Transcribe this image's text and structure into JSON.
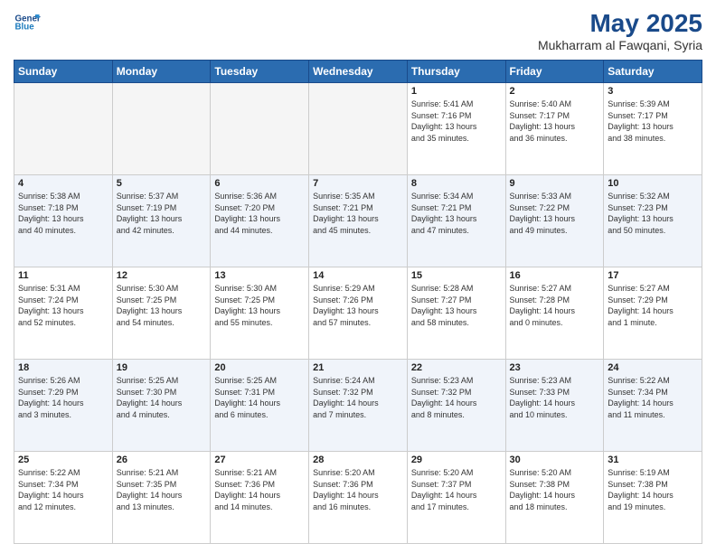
{
  "header": {
    "logo_line1": "General",
    "logo_line2": "Blue",
    "title": "May 2025",
    "subtitle": "Mukharram al Fawqani, Syria"
  },
  "days_of_week": [
    "Sunday",
    "Monday",
    "Tuesday",
    "Wednesday",
    "Thursday",
    "Friday",
    "Saturday"
  ],
  "weeks": [
    [
      {
        "num": "",
        "info": "",
        "empty": true
      },
      {
        "num": "",
        "info": "",
        "empty": true
      },
      {
        "num": "",
        "info": "",
        "empty": true
      },
      {
        "num": "",
        "info": "",
        "empty": true
      },
      {
        "num": "1",
        "info": "Sunrise: 5:41 AM\nSunset: 7:16 PM\nDaylight: 13 hours\nand 35 minutes."
      },
      {
        "num": "2",
        "info": "Sunrise: 5:40 AM\nSunset: 7:17 PM\nDaylight: 13 hours\nand 36 minutes."
      },
      {
        "num": "3",
        "info": "Sunrise: 5:39 AM\nSunset: 7:17 PM\nDaylight: 13 hours\nand 38 minutes."
      }
    ],
    [
      {
        "num": "4",
        "info": "Sunrise: 5:38 AM\nSunset: 7:18 PM\nDaylight: 13 hours\nand 40 minutes."
      },
      {
        "num": "5",
        "info": "Sunrise: 5:37 AM\nSunset: 7:19 PM\nDaylight: 13 hours\nand 42 minutes."
      },
      {
        "num": "6",
        "info": "Sunrise: 5:36 AM\nSunset: 7:20 PM\nDaylight: 13 hours\nand 44 minutes."
      },
      {
        "num": "7",
        "info": "Sunrise: 5:35 AM\nSunset: 7:21 PM\nDaylight: 13 hours\nand 45 minutes."
      },
      {
        "num": "8",
        "info": "Sunrise: 5:34 AM\nSunset: 7:21 PM\nDaylight: 13 hours\nand 47 minutes."
      },
      {
        "num": "9",
        "info": "Sunrise: 5:33 AM\nSunset: 7:22 PM\nDaylight: 13 hours\nand 49 minutes."
      },
      {
        "num": "10",
        "info": "Sunrise: 5:32 AM\nSunset: 7:23 PM\nDaylight: 13 hours\nand 50 minutes."
      }
    ],
    [
      {
        "num": "11",
        "info": "Sunrise: 5:31 AM\nSunset: 7:24 PM\nDaylight: 13 hours\nand 52 minutes."
      },
      {
        "num": "12",
        "info": "Sunrise: 5:30 AM\nSunset: 7:25 PM\nDaylight: 13 hours\nand 54 minutes."
      },
      {
        "num": "13",
        "info": "Sunrise: 5:30 AM\nSunset: 7:25 PM\nDaylight: 13 hours\nand 55 minutes."
      },
      {
        "num": "14",
        "info": "Sunrise: 5:29 AM\nSunset: 7:26 PM\nDaylight: 13 hours\nand 57 minutes."
      },
      {
        "num": "15",
        "info": "Sunrise: 5:28 AM\nSunset: 7:27 PM\nDaylight: 13 hours\nand 58 minutes."
      },
      {
        "num": "16",
        "info": "Sunrise: 5:27 AM\nSunset: 7:28 PM\nDaylight: 14 hours\nand 0 minutes."
      },
      {
        "num": "17",
        "info": "Sunrise: 5:27 AM\nSunset: 7:29 PM\nDaylight: 14 hours\nand 1 minute."
      }
    ],
    [
      {
        "num": "18",
        "info": "Sunrise: 5:26 AM\nSunset: 7:29 PM\nDaylight: 14 hours\nand 3 minutes."
      },
      {
        "num": "19",
        "info": "Sunrise: 5:25 AM\nSunset: 7:30 PM\nDaylight: 14 hours\nand 4 minutes."
      },
      {
        "num": "20",
        "info": "Sunrise: 5:25 AM\nSunset: 7:31 PM\nDaylight: 14 hours\nand 6 minutes."
      },
      {
        "num": "21",
        "info": "Sunrise: 5:24 AM\nSunset: 7:32 PM\nDaylight: 14 hours\nand 7 minutes."
      },
      {
        "num": "22",
        "info": "Sunrise: 5:23 AM\nSunset: 7:32 PM\nDaylight: 14 hours\nand 8 minutes."
      },
      {
        "num": "23",
        "info": "Sunrise: 5:23 AM\nSunset: 7:33 PM\nDaylight: 14 hours\nand 10 minutes."
      },
      {
        "num": "24",
        "info": "Sunrise: 5:22 AM\nSunset: 7:34 PM\nDaylight: 14 hours\nand 11 minutes."
      }
    ],
    [
      {
        "num": "25",
        "info": "Sunrise: 5:22 AM\nSunset: 7:34 PM\nDaylight: 14 hours\nand 12 minutes."
      },
      {
        "num": "26",
        "info": "Sunrise: 5:21 AM\nSunset: 7:35 PM\nDaylight: 14 hours\nand 13 minutes."
      },
      {
        "num": "27",
        "info": "Sunrise: 5:21 AM\nSunset: 7:36 PM\nDaylight: 14 hours\nand 14 minutes."
      },
      {
        "num": "28",
        "info": "Sunrise: 5:20 AM\nSunset: 7:36 PM\nDaylight: 14 hours\nand 16 minutes."
      },
      {
        "num": "29",
        "info": "Sunrise: 5:20 AM\nSunset: 7:37 PM\nDaylight: 14 hours\nand 17 minutes."
      },
      {
        "num": "30",
        "info": "Sunrise: 5:20 AM\nSunset: 7:38 PM\nDaylight: 14 hours\nand 18 minutes."
      },
      {
        "num": "31",
        "info": "Sunrise: 5:19 AM\nSunset: 7:38 PM\nDaylight: 14 hours\nand 19 minutes."
      }
    ]
  ]
}
